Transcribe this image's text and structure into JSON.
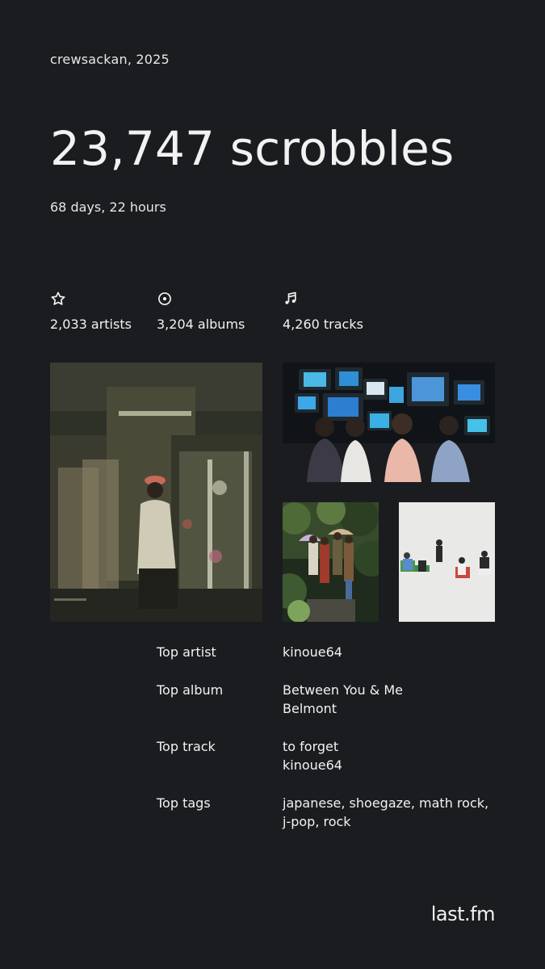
{
  "header": {
    "user_year": "crewsackan, 2025",
    "scrobbles": "23,747 scrobbles",
    "duration": "68 days, 22 hours"
  },
  "stats": {
    "artists": {
      "icon": "star-icon",
      "label": "2,033 artists"
    },
    "albums": {
      "icon": "disc-icon",
      "label": "3,204 albums"
    },
    "tracks": {
      "icon": "music-note-icon",
      "label": "4,260 tracks"
    }
  },
  "top": {
    "artist": {
      "key": "Top artist",
      "value": "kinoue64"
    },
    "album": {
      "key": "Top album",
      "title": "Between You & Me",
      "artist": "Belmont"
    },
    "track": {
      "key": "Top track",
      "title": "to forget",
      "artist": "kinoue64"
    },
    "tags": {
      "key": "Top tags",
      "value": "japanese, shoegaze, math rock, j-pop, rock"
    }
  },
  "brand": {
    "logo": "last.fm"
  },
  "colors": {
    "background": "#1b1c1f",
    "text": "#f2f2f2"
  }
}
